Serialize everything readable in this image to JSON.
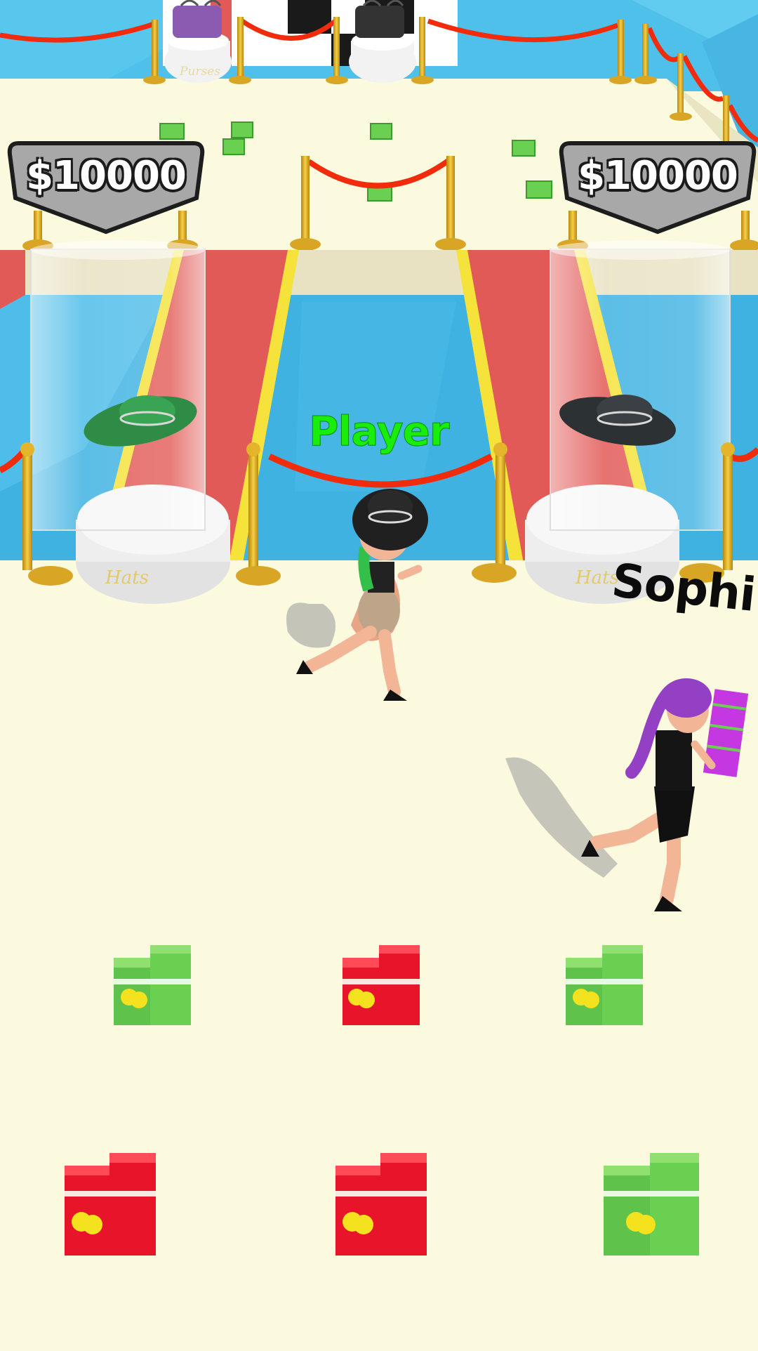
{
  "game": {
    "shop_signs": [
      {
        "price": "$10000"
      },
      {
        "price": "$10000"
      }
    ],
    "pedestal_labels": {
      "far_pedestals": "Purses",
      "near_pedestals": "Hats"
    },
    "player_name": "Player",
    "rival_name": "Sophi",
    "colors": {
      "floor": "#fbf9de",
      "water": "#42b7e6",
      "carpet": "#e25a57",
      "price_sign": "#a8a8a8",
      "player_label": "#19ee0a",
      "rival_label": "#0c0c0c",
      "cash_green": "#6ad052",
      "cash_red": "#e8142a",
      "rope": "#f02c0c",
      "stanchion": "#e4b42a"
    },
    "money_stacks": [
      {
        "color": "green"
      },
      {
        "color": "red"
      },
      {
        "color": "green"
      },
      {
        "color": "red"
      },
      {
        "color": "red"
      },
      {
        "color": "green"
      }
    ]
  }
}
